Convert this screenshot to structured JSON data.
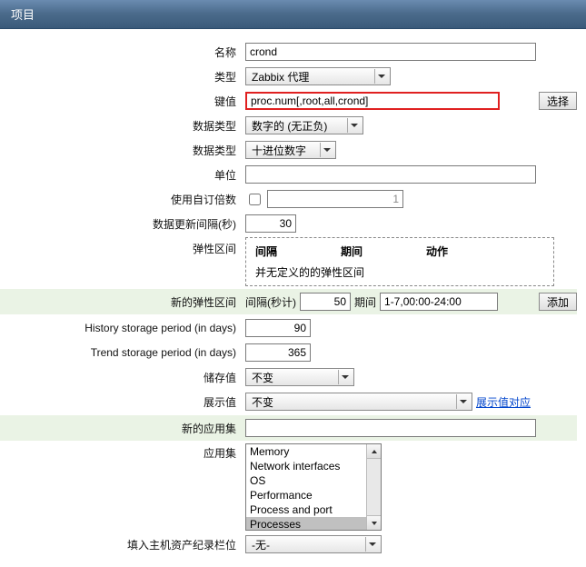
{
  "header": {
    "title": "项目"
  },
  "labels": {
    "name": "名称",
    "type": "类型",
    "key": "键值",
    "select_btn": "选择",
    "data_type": "数据类型",
    "data_type2": "数据类型",
    "unit": "单位",
    "custom_multiplier": "使用自订倍数",
    "update_interval": "数据更新间隔(秒)",
    "flex_interval": "弹性区间",
    "fi_col1": "间隔",
    "fi_col2": "期间",
    "fi_col3": "动作",
    "fi_empty": "并无定义的的弹性区间",
    "new_flex_interval": "新的弹性区间",
    "fi_interval_label": "间隔(秒计)",
    "fi_period_label": "期间",
    "add_btn": "添加",
    "history_period": "History storage period (in days)",
    "trend_period": "Trend storage period (in days)",
    "store_value": "储存值",
    "show_value": "展示值",
    "show_value_link": "展示值对应",
    "new_app_set": "新的应用集",
    "app_set": "应用集",
    "host_inventory": "填入主机资产纪录栏位"
  },
  "values": {
    "name": "crond",
    "type": "Zabbix 代理",
    "key": "proc.num[,root,all,crond]",
    "data_type": "数字的 (无正负)",
    "data_type2": "十进位数字",
    "unit": "",
    "multiplier_enabled": false,
    "multiplier_value": "1",
    "update_interval": "30",
    "new_fi_seconds": "50",
    "new_fi_period": "1-7,00:00-24:00",
    "history_period": "90",
    "trend_period": "365",
    "store_value": "不变",
    "show_value": "不变",
    "new_app_set": "",
    "app_set_options": [
      "Memory",
      "Network interfaces",
      "OS",
      "Performance",
      "Process and port",
      "Processes"
    ],
    "app_set_selected": "Processes",
    "host_inventory": "-无-"
  }
}
